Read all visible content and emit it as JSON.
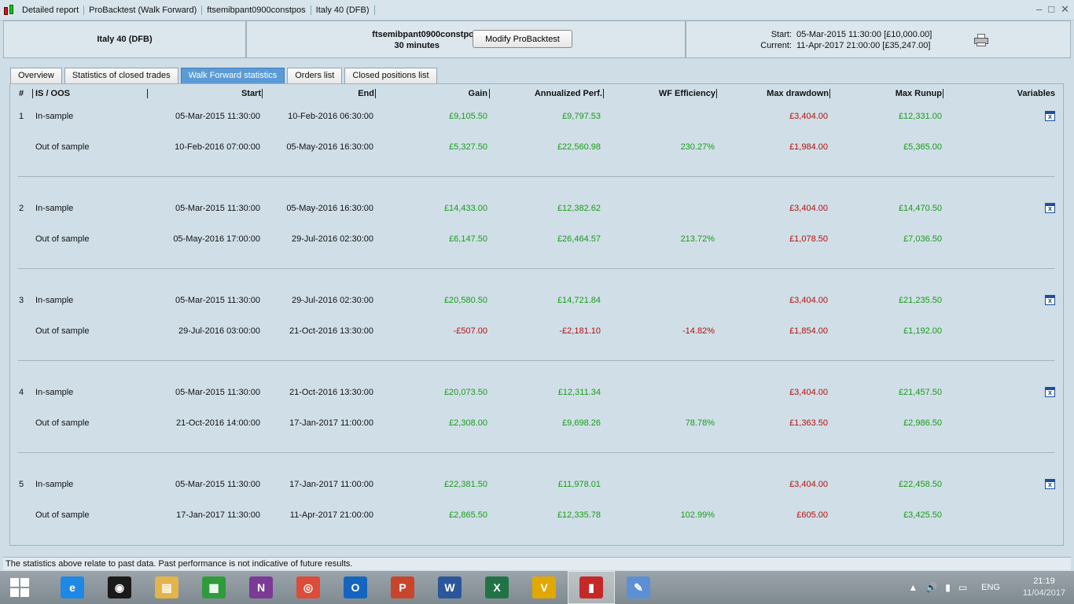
{
  "window": {
    "title_segments": [
      "Detailed report",
      "ProBacktest (Walk Forward)",
      "ftsemibpant0900constpos",
      "Italy 40 (DFB)"
    ],
    "controls": [
      "–",
      "□",
      "✕"
    ]
  },
  "header": {
    "instrument": "Italy 40 (DFB)",
    "strategy_name": "ftsemibpant0900constpos",
    "timeframe": "30 minutes",
    "modify_button": "Modify ProBacktest",
    "start_label": "Start:",
    "start_value": "05-Mar-2015 11:30:00 [£10,000.00]",
    "current_label": "Current:",
    "current_value": "11-Apr-2017 21:00:00 [£35,247.00]"
  },
  "tabs": [
    {
      "label": "Overview",
      "active": false
    },
    {
      "label": "Statistics of closed trades",
      "active": false
    },
    {
      "label": "Walk Forward statistics",
      "active": true
    },
    {
      "label": "Orders list",
      "active": false
    },
    {
      "label": "Closed positions list",
      "active": false
    }
  ],
  "table": {
    "columns": {
      "num": "#",
      "type": "IS / OOS",
      "start": "Start",
      "end": "End",
      "gain": "Gain",
      "annualized": "Annualized Perf.",
      "wf_eff": "WF Efficiency",
      "max_dd": "Max drawdown",
      "max_runup": "Max Runup",
      "variables": "Variables"
    },
    "groups": [
      {
        "num": "1",
        "is": {
          "type": "In-sample",
          "start": "05-Mar-2015 11:30:00",
          "end": "10-Feb-2016 06:30:00",
          "gain": "£9,105.50",
          "annualized": "£9,797.53",
          "wf_eff": "",
          "max_dd": "£3,404.00",
          "max_runup": "£12,331.00"
        },
        "oos": {
          "type": "Out of sample",
          "start": "10-Feb-2016 07:00:00",
          "end": "05-May-2016 16:30:00",
          "gain": "£5,327.50",
          "annualized": "£22,560.98",
          "wf_eff": "230.27%",
          "max_dd": "£1,984.00",
          "max_runup": "£5,365.00"
        }
      },
      {
        "num": "2",
        "is": {
          "type": "In-sample",
          "start": "05-Mar-2015 11:30:00",
          "end": "05-May-2016 16:30:00",
          "gain": "£14,433.00",
          "annualized": "£12,382.62",
          "wf_eff": "",
          "max_dd": "£3,404.00",
          "max_runup": "£14,470.50"
        },
        "oos": {
          "type": "Out of sample",
          "start": "05-May-2016 17:00:00",
          "end": "29-Jul-2016 02:30:00",
          "gain": "£6,147.50",
          "annualized": "£26,464.57",
          "wf_eff": "213.72%",
          "max_dd": "£1,078.50",
          "max_runup": "£7,036.50"
        }
      },
      {
        "num": "3",
        "is": {
          "type": "In-sample",
          "start": "05-Mar-2015 11:30:00",
          "end": "29-Jul-2016 02:30:00",
          "gain": "£20,580.50",
          "annualized": "£14,721.84",
          "wf_eff": "",
          "max_dd": "£3,404.00",
          "max_runup": "£21,235.50"
        },
        "oos": {
          "type": "Out of sample",
          "start": "29-Jul-2016 03:00:00",
          "end": "21-Oct-2016 13:30:00",
          "gain": "-£507.00",
          "annualized": "-£2,181.10",
          "wf_eff": "-14.82%",
          "max_dd": "£1,854.00",
          "max_runup": "£1,192.00"
        }
      },
      {
        "num": "4",
        "is": {
          "type": "In-sample",
          "start": "05-Mar-2015 11:30:00",
          "end": "21-Oct-2016 13:30:00",
          "gain": "£20,073.50",
          "annualized": "£12,311.34",
          "wf_eff": "",
          "max_dd": "£3,404.00",
          "max_runup": "£21,457.50"
        },
        "oos": {
          "type": "Out of sample",
          "start": "21-Oct-2016 14:00:00",
          "end": "17-Jan-2017 11:00:00",
          "gain": "£2,308.00",
          "annualized": "£9,698.26",
          "wf_eff": "78.78%",
          "max_dd": "£1,363.50",
          "max_runup": "£2,986.50"
        }
      },
      {
        "num": "5",
        "is": {
          "type": "In-sample",
          "start": "05-Mar-2015 11:30:00",
          "end": "17-Jan-2017 11:00:00",
          "gain": "£22,381.50",
          "annualized": "£11,978.01",
          "wf_eff": "",
          "max_dd": "£3,404.00",
          "max_runup": "£22,458.50"
        },
        "oos": {
          "type": "Out of sample",
          "start": "17-Jan-2017 11:30:00",
          "end": "11-Apr-2017 21:00:00",
          "gain": "£2,865.50",
          "annualized": "£12,335.78",
          "wf_eff": "102.99%",
          "max_dd": "£605.00",
          "max_runup": "£3,425.50"
        }
      }
    ]
  },
  "footer_text": "The statistics above relate to past data. Past performance is not indicative of future results.",
  "taskbar": {
    "apps": [
      {
        "name": "internet-explorer-icon",
        "glyph": "e",
        "color": "#1e88e5",
        "active": false
      },
      {
        "name": "media-player-icon",
        "glyph": "◉",
        "color": "#1a1a1a",
        "active": false
      },
      {
        "name": "file-explorer-icon",
        "glyph": "▤",
        "color": "#e3b44a",
        "active": false
      },
      {
        "name": "store-icon",
        "glyph": "▦",
        "color": "#2e9c3b",
        "active": false
      },
      {
        "name": "onenote-icon",
        "glyph": "N",
        "color": "#7b3a96",
        "active": false
      },
      {
        "name": "chrome-icon",
        "glyph": "◎",
        "color": "#dd4b39",
        "active": false
      },
      {
        "name": "outlook-icon",
        "glyph": "O",
        "color": "#1565c0",
        "active": false
      },
      {
        "name": "powerpoint-icon",
        "glyph": "P",
        "color": "#c8452b",
        "active": false
      },
      {
        "name": "word-icon",
        "glyph": "W",
        "color": "#2b579a",
        "active": false
      },
      {
        "name": "excel-icon",
        "glyph": "X",
        "color": "#217346",
        "active": false
      },
      {
        "name": "prorealtime-v-icon",
        "glyph": "V",
        "color": "#e0a800",
        "active": false
      },
      {
        "name": "prorealtime-chart-icon",
        "glyph": "▮",
        "color": "#c62828",
        "active": true
      },
      {
        "name": "paint-icon",
        "glyph": "✎",
        "color": "#5c8fd6",
        "active": false
      }
    ],
    "tray_icons": [
      "▲",
      "🔊",
      "▮",
      "▭"
    ],
    "language": "ENG",
    "time": "21:19",
    "date": "11/04/2017"
  },
  "colors": {
    "positive": "#1a9a1a",
    "negative": "#b01010",
    "active_tab": "#5b9bd5"
  }
}
